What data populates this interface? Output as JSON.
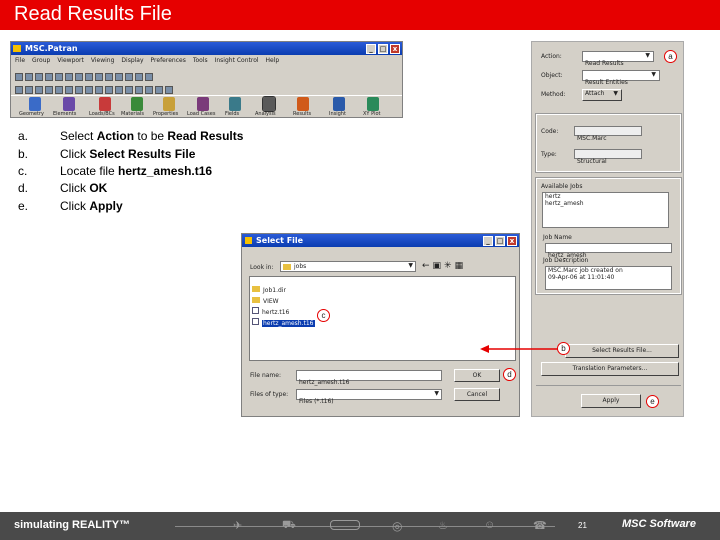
{
  "slide_title": "Read Results File",
  "patran_window": {
    "title": "MSC.Patran",
    "menu": [
      "File",
      "Group",
      "Viewport",
      "Viewing",
      "Display",
      "Preferences",
      "Tools",
      "Insight Control",
      "Help"
    ],
    "apps": [
      "Geometry",
      "Elements",
      "Loads/BCs",
      "Materials",
      "Properties",
      "Load Cases",
      "Fields",
      "Analysis",
      "Results",
      "Insight",
      "XY Plot"
    ]
  },
  "steps": [
    {
      "letter": "a.",
      "pre": "Select ",
      "b1": "Action",
      "mid": " to be ",
      "b2": "Read Results"
    },
    {
      "letter": "b.",
      "pre": "Click ",
      "b1": "Select Results File",
      "mid": "",
      "b2": ""
    },
    {
      "letter": "c.",
      "pre": "Locate file ",
      "b1": "hertz_amesh.t16",
      "mid": "",
      "b2": ""
    },
    {
      "letter": "d.",
      "pre": "Click ",
      "b1": "OK",
      "mid": "",
      "b2": ""
    },
    {
      "letter": "e.",
      "pre": "Click ",
      "b1": "Apply",
      "mid": "",
      "b2": ""
    }
  ],
  "right_panel": {
    "action_label": "Action:",
    "action_value": "Read Results",
    "object_label": "Object:",
    "object_value": "Result Entities",
    "method_label": "Method:",
    "method_value": "Attach",
    "code_label": "Code:",
    "code_value": "MSC.Marc",
    "type_label": "Type:",
    "type_value": "Structural",
    "jobs_label": "Available Jobs",
    "jobs": [
      "hertz",
      "hertz_amesh"
    ],
    "job_name_label": "Job Name",
    "job_name_value": "hertz_amesh",
    "job_desc_label": "Job Description",
    "job_desc_lines": [
      "MSC.Marc job created on",
      "09-Apr-06 at 11:01:40"
    ],
    "select_results_btn": "Select Results File...",
    "translation_btn": "Translation Parameters...",
    "apply_btn": "Apply"
  },
  "file_dialog": {
    "title": "Select File",
    "look_in_label": "Look in:",
    "look_in_value": "jobs",
    "files": [
      {
        "name": "Job1.dir",
        "type": "folder"
      },
      {
        "name": "VIEW",
        "type": "folder"
      },
      {
        "name": "hertz.t16",
        "type": "file"
      },
      {
        "name": "hertz_amesh.t16",
        "type": "file"
      }
    ],
    "file_name_label": "File name:",
    "file_name_value": "hertz_amesh.t16",
    "file_type_label": "Files of type:",
    "file_type_value": "Files (*.t16)",
    "ok_label": "OK",
    "cancel_label": "Cancel"
  },
  "callouts": {
    "a": "a",
    "b": "b",
    "c": "c",
    "d": "d",
    "e": "e"
  },
  "footer": {
    "tagline": "simulating REALITY™",
    "page": "21",
    "brand": "MSC Software"
  },
  "colors": {
    "title_red": "#e60000",
    "footer_gray": "#4a4a4a",
    "xp_blue": "#0a3cb0"
  }
}
